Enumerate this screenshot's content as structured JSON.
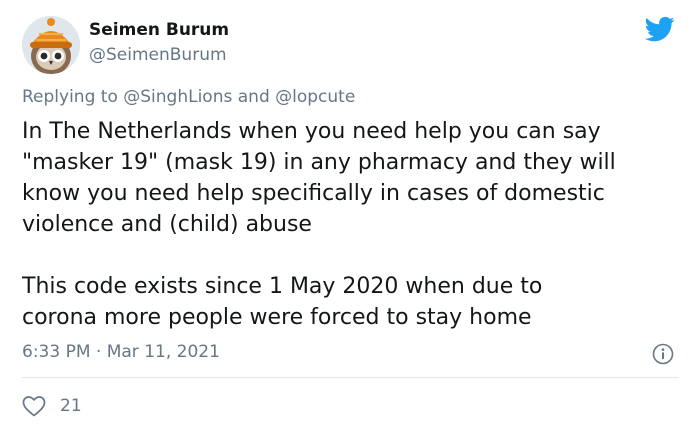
{
  "author": {
    "display_name": "Seimen Burum",
    "handle": "@SeimenBurum",
    "avatar_icon": "owl-avatar-orange-knit-hat"
  },
  "reply": {
    "prefix": "Replying to ",
    "mention_1": "@SinghLions",
    "joiner": " and ",
    "mention_2": "@lopcute"
  },
  "body": {
    "lines": [
      "In The Netherlands when you need help you can say",
      "\"masker 19\" (mask 19) in any pharmacy and they will",
      "know you need help specifically in cases of domestic",
      "violence and (child) abuse",
      "This code exists since 1 May 2020 when due to",
      "corona more people were forced to stay home"
    ]
  },
  "meta": {
    "timestamp": "6:33 PM · Mar 11, 2021",
    "info_icon": "info-icon"
  },
  "actions": {
    "like_icon": "heart-outline-icon",
    "like_count": "21"
  },
  "colors": {
    "brand": "#1da1f2",
    "muted": "#657786",
    "text": "#14171a",
    "divider": "#e1e8ed"
  }
}
